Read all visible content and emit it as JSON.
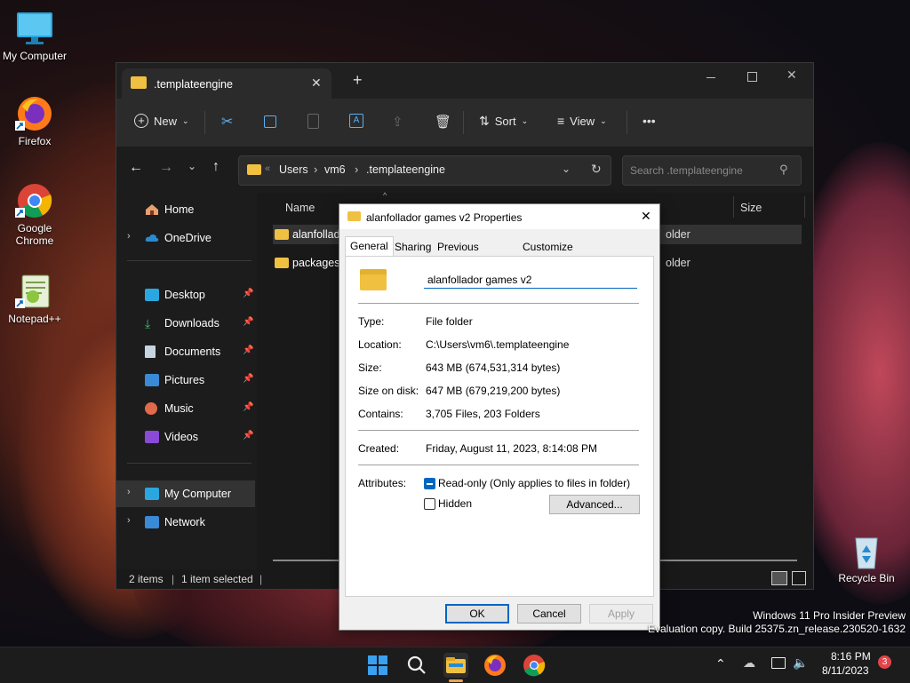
{
  "desktop": {
    "icons": [
      {
        "label": "My Computer"
      },
      {
        "label": "Firefox"
      },
      {
        "label": "Google Chrome"
      },
      {
        "label": "Notepad++"
      },
      {
        "label": "Recycle Bin"
      }
    ],
    "watermark": {
      "line1": "Windows 11 Pro Insider Preview",
      "line2": "Evaluation copy. Build 25375.zn_release.230520-1632"
    }
  },
  "explorer": {
    "tab_title": ".templateengine",
    "new_tab_label": "+",
    "toolbar": {
      "new_label": "New",
      "sort_label": "Sort",
      "view_label": "View",
      "more_label": "•••"
    },
    "breadcrumb": [
      "Users",
      "vm6",
      ".templateengine"
    ],
    "breadcrumb_sep": "›",
    "breadcrumb_prefix": "«",
    "search_placeholder": "Search .templateengine",
    "nav": {
      "home": "Home",
      "onedrive": "OneDrive",
      "desktop": "Desktop",
      "downloads": "Downloads",
      "documents": "Documents",
      "pictures": "Pictures",
      "music": "Music",
      "videos": "Videos",
      "my_computer": "My Computer",
      "network": "Network"
    },
    "columns": {
      "name": "Name",
      "size": "Size"
    },
    "files": [
      {
        "name": "alanfollad",
        "type_fragment": "older"
      },
      {
        "name": "packages",
        "type_fragment": "older"
      }
    ],
    "status": {
      "items": "2 items",
      "selected": "1 item selected"
    }
  },
  "dialog": {
    "title": "alanfollador games v2 Properties",
    "tabs": [
      "General",
      "Sharing",
      "Previous Versions",
      "Customize"
    ],
    "folder_name": "alanfollador games v2",
    "props": {
      "type_label": "Type:",
      "type_value": "File folder",
      "location_label": "Location:",
      "location_value": "C:\\Users\\vm6\\.templateengine",
      "size_label": "Size:",
      "size_value": "643 MB (674,531,314 bytes)",
      "sod_label": "Size on disk:",
      "sod_value": "647 MB (679,219,200 bytes)",
      "contains_label": "Contains:",
      "contains_value": "3,705 Files, 203 Folders",
      "created_label": "Created:",
      "created_value": "Friday, August 11, 2023, 8:14:08 PM",
      "attributes_label": "Attributes:",
      "readonly_label": "Read-only (Only applies to files in folder)",
      "hidden_label": "Hidden",
      "advanced_label": "Advanced..."
    },
    "buttons": {
      "ok": "OK",
      "cancel": "Cancel",
      "apply": "Apply"
    }
  },
  "taskbar": {
    "time": "8:16 PM",
    "date": "8/11/2023",
    "notification_count": "3"
  },
  "colors": {
    "accent": "#0067c0",
    "folder": "#f0c040"
  }
}
